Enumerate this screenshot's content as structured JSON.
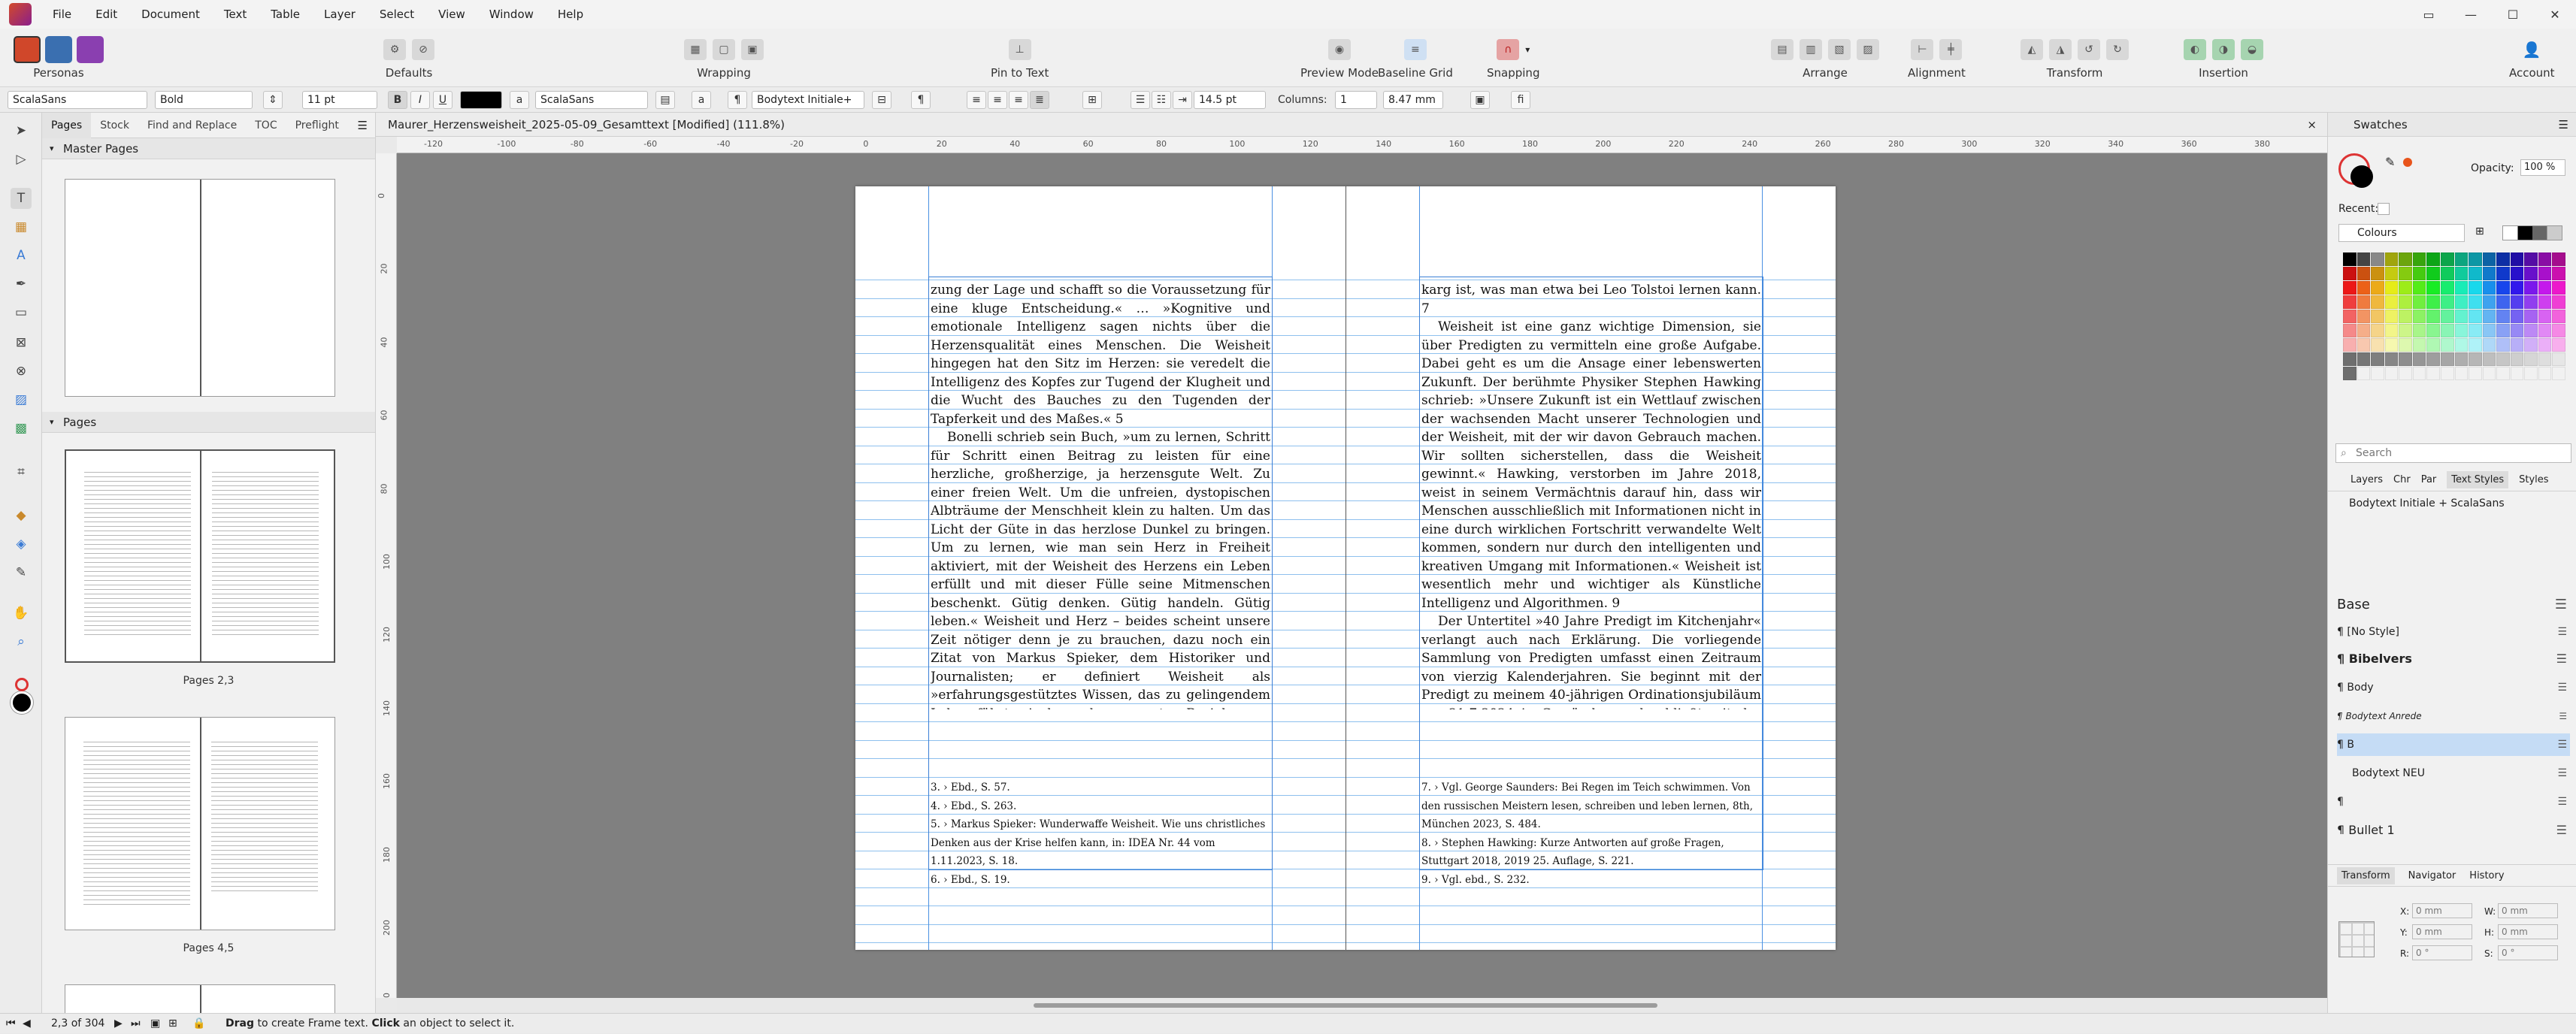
{
  "menu": [
    "File",
    "Edit",
    "Document",
    "Text",
    "Table",
    "Layer",
    "Select",
    "View",
    "Window",
    "Help"
  ],
  "toolbar": {
    "personas": "Personas",
    "defaults": "Defaults",
    "wrapping": "Wrapping",
    "pin_to_text": "Pin to Text",
    "preview_mode": "Preview Mode",
    "baseline_grid": "Baseline Grid",
    "snapping": "Snapping",
    "arrange": "Arrange",
    "alignment": "Alignment",
    "transform": "Transform",
    "insertion": "Insertion",
    "account": "Account"
  },
  "context": {
    "font_family": "ScalaSans",
    "font_style": "Bold",
    "font_size": "11 pt",
    "bold": "B",
    "italic": "I",
    "underline": "U",
    "font_family2": "ScalaSans",
    "para_style": "Bodytext Initiale+",
    "leading": "14.5 pt",
    "columns_label": "Columns:",
    "columns": "1",
    "gutter": "8.47 mm",
    "fi": "fi"
  },
  "left_panel": {
    "tabs": [
      "Pages",
      "Stock",
      "Find and Replace",
      "TOC",
      "Preflight"
    ],
    "master_pages": "Master Pages",
    "pages": "Pages",
    "thumb_labels": [
      "Pages 2,3",
      "Pages 4,5"
    ]
  },
  "document": {
    "tab_title": "Maurer_Herzensweisheit_2025-05-09_Gesamttext [Modified] (111.8%)",
    "close": "×",
    "h_ruler": [
      "-120",
      "-100",
      "-80",
      "-60",
      "-40",
      "-20",
      "0",
      "20",
      "40",
      "60",
      "80",
      "100",
      "120",
      "140",
      "160",
      "180",
      "200",
      "220",
      "240",
      "260",
      "280",
      "300",
      "320",
      "340",
      "360",
      "380",
      "400"
    ],
    "v_ruler": [
      "0",
      "20",
      "40",
      "60",
      "80",
      "100",
      "120",
      "140",
      "160",
      "180",
      "200",
      "220"
    ],
    "left_page": {
      "paragraphs": [
        "zung der Lage und schafft so die Voraussetzung für eine kluge Entscheidung.« … »Kognitive und emotionale Intelligenz sagen nichts über die Herzensqualität eines Menschen. Die Weisheit hingegen hat den Sitz im Herzen: sie veredelt die Intelligenz des Kopfes zur Tugend der Klugheit und die Wucht des Bauches zu den Tugenden der Tapferkeit und des Maßes.« 5",
        "Bonelli schrieb sein Buch, »um zu lernen, Schritt für Schritt einen Beitrag zu leisten für eine herzliche, großherzige, ja herzensgute Welt. Zu einer freien Welt. Um die unfreien, dystopischen Albträume der Menschheit klein zu halten. Um das Licht der Güte in das herzlose Dunkel zu bringen. Um zu lernen, wie man sein Herz in Freiheit aktiviert, mit der Weisheit des Herzens ein Leben erfüllt und mit dieser Fülle seine Mitmenschen beschenkt. Gütig denken. Gütig handeln. Gütig leben.« Weisheit und Herz – beides scheint unsere Zeit nötiger denn je zu brauchen, dazu noch ein Zitat von Markus Spieker, dem Historiker und Journalisten; er definiert Weisheit als »erfahrungsgestütztes Wissen, das zu gelingendem Leben führt – insbesondere zu guten Beziehungen miteinander und mit Gott«. Weisheit sei »unter anderem die Fähigkeit, aus dem Schaden anderer Epochen klug geworden zu sein und die zur Verfügung stehenden Daten so zu interpretieren, dass man bestimmte Fehler gar nicht erst macht.« Seine Schlussfolgerung: »Eine weise Kirche wird dringender gebraucht denn je.« Gegenüber dem Wortreichtum von Kirche heute sei dabei erinnert, dass echte Weisheit wort-"
      ],
      "footnotes": [
        "3. › Ebd., S. 57.",
        "4. › Ebd., S. 263.",
        "5. › Markus Spieker: Wunderwaffe Weisheit. Wie uns christliches Denken aus der Krise helfen kann, in: IDEA Nr. 44 vom 1.11.2023, S. 18.",
        "6. › Ebd., S. 19."
      ]
    },
    "right_page": {
      "paragraphs": [
        "karg ist, was man etwa bei Leo Tolstoi lernen kann. 7",
        "Weisheit ist eine ganz wichtige Dimension, sie über Predigten zu vermitteln eine große Aufgabe. Dabei geht es um die Ansage einer lebenswerten Zukunft. Der berühmte Physiker Stephen Hawking schrieb: »Unsere Zukunft ist ein Wettlauf zwischen der wachsenden Macht unserer Technologien und der Weisheit, mit der wir davon Gebrauch machen. Wir sollten sicherstellen, dass die Weisheit gewinnt.« Hawking, verstorben im Jahre 2018, weist in seinem Vermächtnis darauf hin, dass wir Menschen ausschließlich mit Informationen nicht in eine durch wirklichen Fortschritt verwandelte Welt kommen, sondern nur durch den intelligenten und kreativen Umgang mit Informationen.« Weisheit ist wesentlich mehr und wichtiger als Künstliche Intelligenz und Algorithmen. 9",
        "Der Untertitel »40 Jahre Predigt im Kitchenjahr« verlangt auch nach Erklärung. Die vorliegende Sammlung von Predigten umfasst einen Zeitraum von vierzig Kalenderjahren. Sie beginnt mit der Predigt zu meinem 40-jährigen Ordinationsjubiläum am 21.7.2024 in Gemünden und schließt mit der Predigt, die ich bei meiner Ordination am 21.7.1984 in Saarbrücken gehalten habe. Walther Henßen, Pfarrer im Ruhestand, begleitet meinen Weg seit meinem Theologiestudium, war mein Mentor beim Gemeindepraktikum. Als Freund kam er zur Feier meines 40-jährigen Ordinationsjubiläum und wies in seiner Ansprache auf die Symbolik der Zahl 40 in der Bibel hin: 40 Tage und 40"
      ],
      "footnotes": [
        "7. › Vgl. George Saunders: Bei Regen im Teich schwimmen. Von den russischen Meistern lesen, schreiben und leben lernen, 8th, München 2023, S. 484.",
        "8. › Stephen Hawking: Kurze Antworten auf große Fragen, Stuttgart 2018, 2019 25. Auflage, S. 221.",
        "9. › Vgl. ebd., S. 232."
      ]
    }
  },
  "right_panel": {
    "swatches_tab": "Swatches",
    "opacity_label": "Opacity:",
    "opacity": "100 %",
    "recent_label": "Recent:",
    "palette": "Colours",
    "search_placeholder": "Search",
    "style_tabs": [
      "Layers",
      "Chr",
      "Par",
      "Text Styles",
      "Styles"
    ],
    "current_style": "Bodytext Initiale + ScalaSans",
    "styles": [
      "Base",
      "¶ [No Style]",
      "¶ Bibelvers",
      "¶ Body",
      "¶ Bodytext Anrede",
      "¶ B",
      "Bodytext NEU",
      "¶",
      "¶ Bullet 1"
    ],
    "bottom_tabs": [
      "Transform",
      "Navigator",
      "History"
    ],
    "transform_fields": {
      "x_label": "X:",
      "x": "0 mm",
      "w_label": "W:",
      "w": "0 mm",
      "y_label": "Y:",
      "y": "0 mm",
      "h_label": "H:",
      "h": "0 mm",
      "r_label": "R:",
      "r": "0 °",
      "s_label": "S:",
      "s": "0 °"
    }
  },
  "status": {
    "page_indicator": "2,3 of 304",
    "hint_bold1": "Drag",
    "hint1": " to create Frame text. ",
    "hint_bold2": "Click",
    "hint2": " an object to select it."
  },
  "colors": {
    "guide": "#4a90e2",
    "baseline": "#8ec0ee",
    "pasteboard": "#808080",
    "selected_style": "#c5dcf5"
  }
}
